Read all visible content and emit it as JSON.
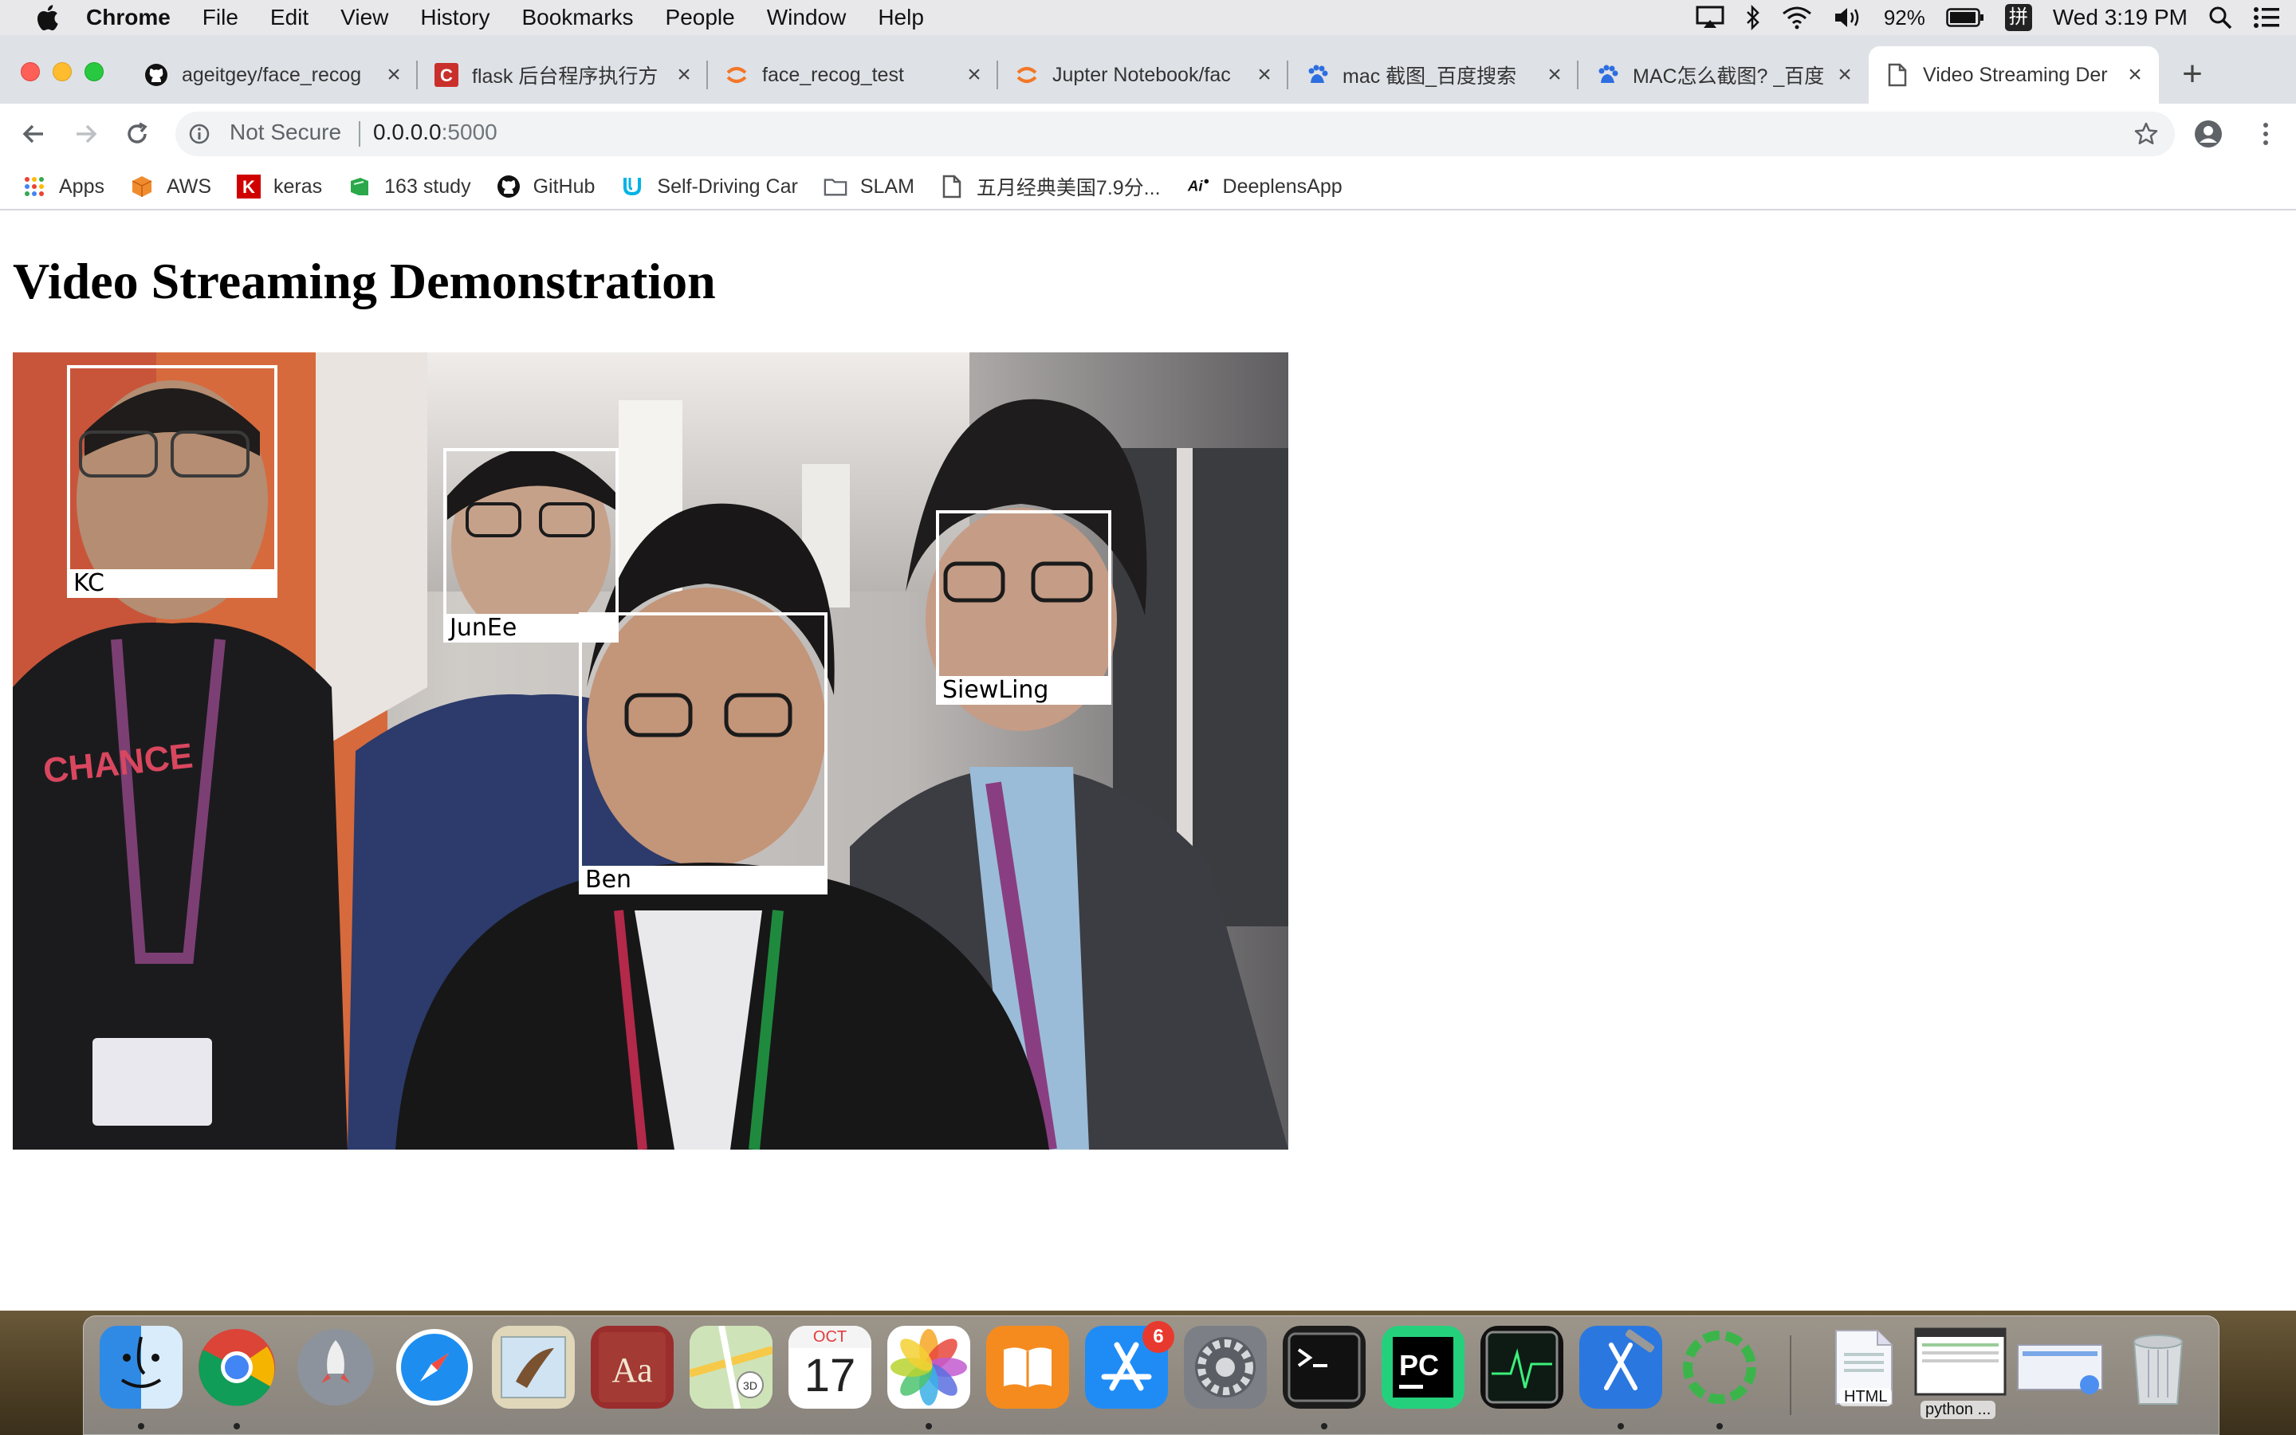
{
  "menubar": {
    "app_name": "Chrome",
    "menus": [
      "File",
      "Edit",
      "View",
      "History",
      "Bookmarks",
      "People",
      "Window",
      "Help"
    ],
    "battery_percent": "92%",
    "input_method": "拼",
    "datetime": "Wed 3:19 PM"
  },
  "tabs": [
    {
      "title": "ageitgey/face_recog",
      "icon": "github-icon"
    },
    {
      "title": "flask 后台程序执行方",
      "icon": "csdn-icon"
    },
    {
      "title": "face_recog_test",
      "icon": "jupyter-icon"
    },
    {
      "title": "Jupter Notebook/fac",
      "icon": "jupyter-icon"
    },
    {
      "title": "mac 截图_百度搜索",
      "icon": "baidu-icon"
    },
    {
      "title": "MAC怎么截图? _百度",
      "icon": "baidu-icon"
    },
    {
      "title": "Video Streaming Der",
      "icon": "page-icon",
      "active": true
    }
  ],
  "omnibox": {
    "security_label": "Not Secure",
    "url_host": "0.0.0.0",
    "url_port": ":5000"
  },
  "bookmarks": [
    {
      "label": "Apps",
      "icon": "apps-grid-icon"
    },
    {
      "label": "AWS",
      "icon": "aws-cube-icon"
    },
    {
      "label": "keras",
      "icon": "keras-icon"
    },
    {
      "label": "163 study",
      "icon": "study-icon"
    },
    {
      "label": "GitHub",
      "icon": "github-icon"
    },
    {
      "label": "Self-Driving Car",
      "icon": "udacity-icon"
    },
    {
      "label": "SLAM",
      "icon": "folder-icon"
    },
    {
      "label": "五月经典美国7.9分...",
      "icon": "page-icon"
    },
    {
      "label": "DeeplensApp",
      "icon": "deeplens-icon"
    }
  ],
  "page": {
    "heading": "Video Streaming Demonstration"
  },
  "faces": [
    {
      "name": "KC"
    },
    {
      "name": "JunEe"
    },
    {
      "name": "Ben"
    },
    {
      "name": "SiewLing"
    }
  ],
  "dock": {
    "calendar_month": "OCT",
    "calendar_day": "17",
    "appstore_badge": "6",
    "python_caption": "python ...",
    "html_caption": "HTML"
  },
  "colors": {
    "close_button": "#fe5f57",
    "minimize_button": "#febc2e",
    "zoom_button": "#28c840",
    "tabstrip_bg": "#dee1e6",
    "face_box": "#ffffff"
  }
}
